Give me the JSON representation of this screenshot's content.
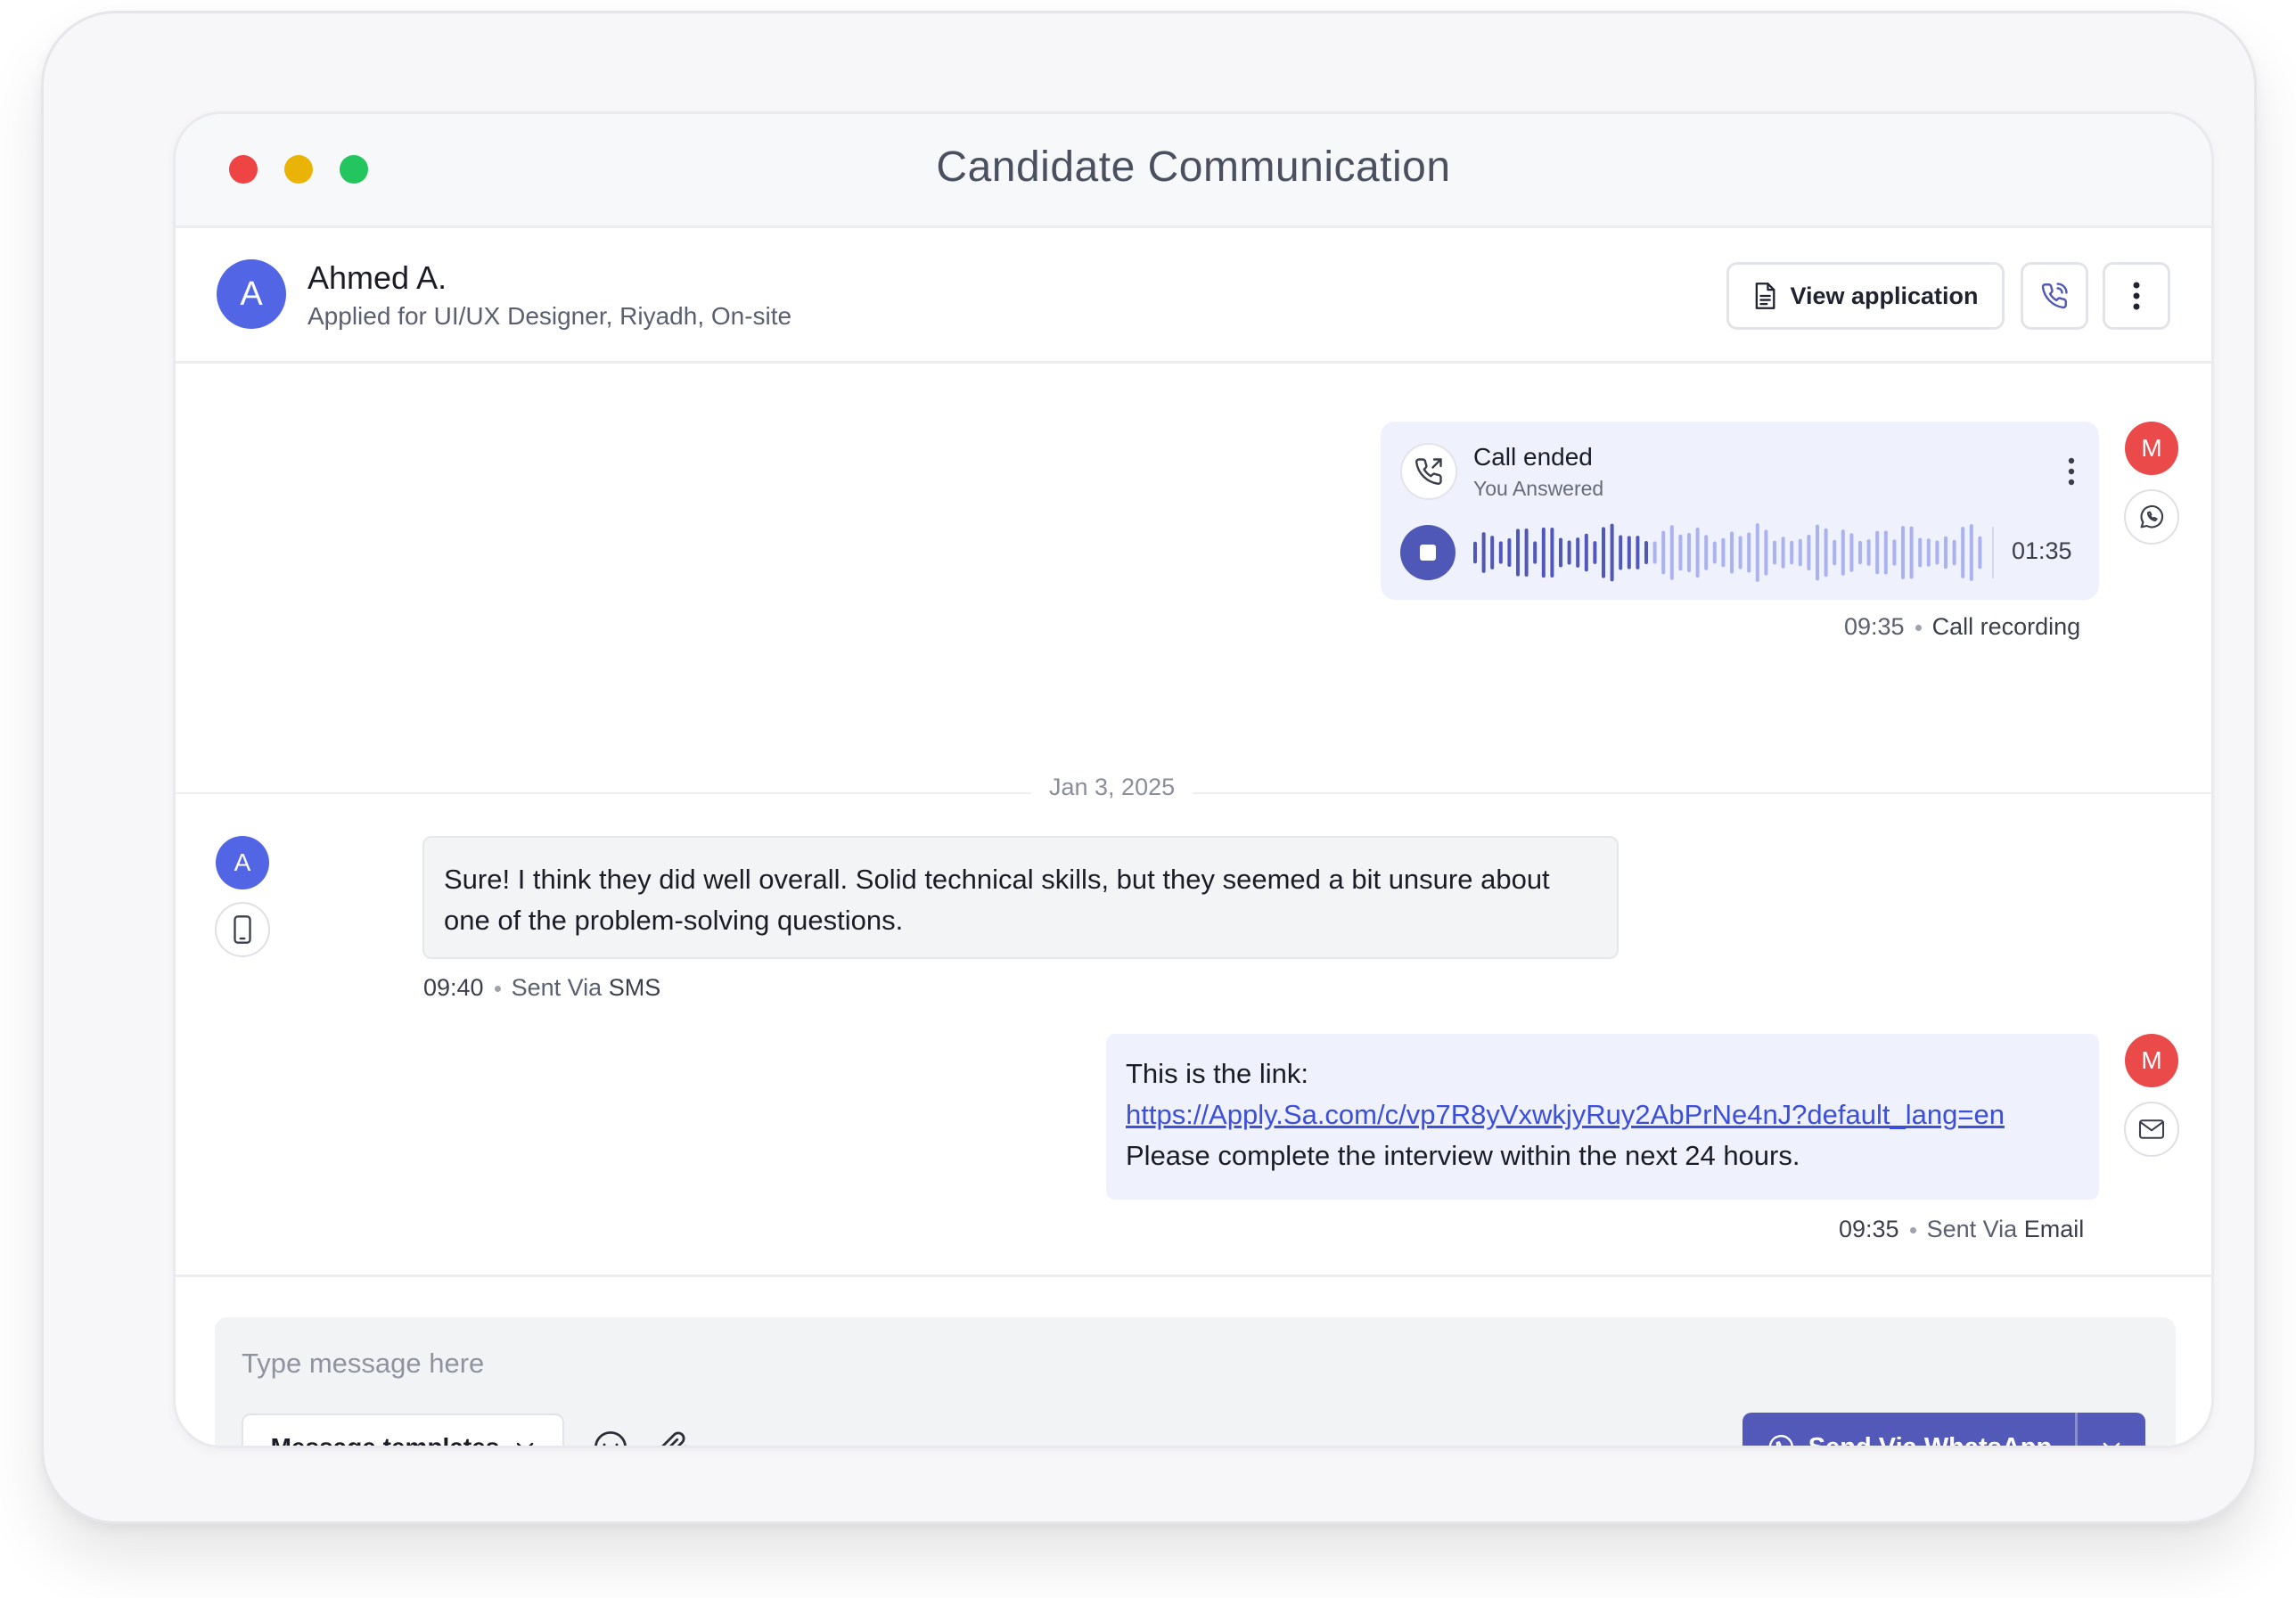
{
  "window": {
    "title": "Candidate Communication"
  },
  "candidate": {
    "initial": "A",
    "name": "Ahmed A.",
    "subtitle": "Applied for UI/UX Designer, Riyadh, On-site"
  },
  "header_actions": {
    "view_application_label": "View application"
  },
  "call": {
    "title": "Call ended",
    "subtitle": "You Answered",
    "duration": "01:35",
    "time": "09:35",
    "label": "Call recording",
    "progress": 0.35,
    "sender_initial": "M",
    "channel_icon": "whatsapp-icon"
  },
  "date_divider": "Jan 3, 2025",
  "messages": [
    {
      "sender_initial": "A",
      "text": "Sure! I think they did well overall. Solid technical skills, but they seemed a bit unsure about one of the problem-solving questions.",
      "time": "09:40",
      "sent_via_prefix": "Sent Via",
      "channel": "SMS",
      "channel_icon": "mobile-icon"
    },
    {
      "sender_initial": "M",
      "line1": "This is the link:",
      "link": "https://Apply.Sa.com/c/vp7R8yVxwkjyRuy2AbPrNe4nJ?default_lang=en",
      "line3": "Please complete the interview within the next 24 hours.",
      "time": "09:35",
      "sent_via_prefix": "Sent Via",
      "channel": "Email",
      "channel_icon": "mail-icon"
    }
  ],
  "composer": {
    "placeholder": "Type message here",
    "value": "",
    "templates_label": "Message templates",
    "send_label": "Send Via WhatsApp"
  },
  "colors": {
    "accent": "#5359b8",
    "avatar_candidate": "#5165e5",
    "avatar_me": "#ea4a4a",
    "bubble_out": "#eff1fd",
    "bubble_in": "#f3f4f6",
    "link": "#3b4fd8"
  }
}
